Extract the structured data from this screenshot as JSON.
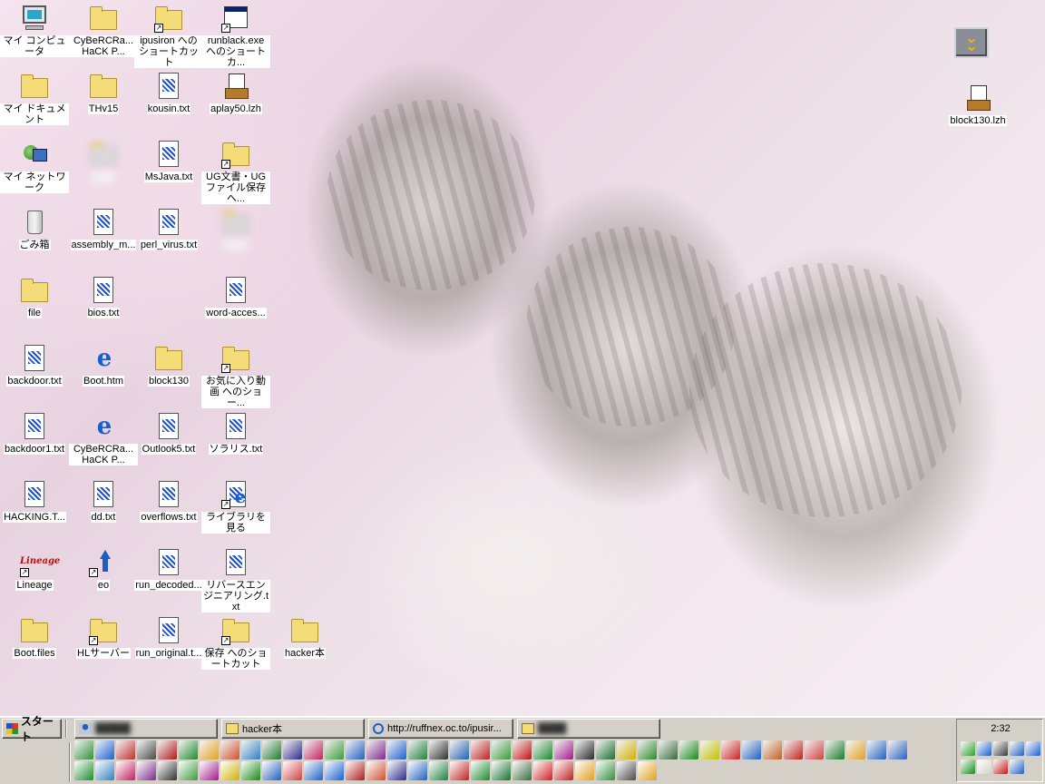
{
  "desktop": {
    "icons": [
      {
        "label": "マイ コンピュータ",
        "kind": "computer"
      },
      {
        "label": "CyBeRCRa... HaCK P...",
        "kind": "folder"
      },
      {
        "label": "ipusiron へのショートカット",
        "kind": "folder-shortcut"
      },
      {
        "label": "runblack.exe へのショートカ...",
        "kind": "exe-shortcut"
      },
      {
        "label": "マイ ドキュメント",
        "kind": "mydocs"
      },
      {
        "label": "THv15",
        "kind": "folder"
      },
      {
        "label": "kousin.txt",
        "kind": "doc"
      },
      {
        "label": "aplay50.lzh",
        "kind": "lzh"
      },
      {
        "label": "マイ ネットワーク",
        "kind": "network"
      },
      {
        "label": "",
        "kind": "blurred"
      },
      {
        "label": "MsJava.txt",
        "kind": "doc"
      },
      {
        "label": "UG文書・UGファイル保存 へ...",
        "kind": "folder-shortcut"
      },
      {
        "label": "ごみ箱",
        "kind": "trash"
      },
      {
        "label": "assembly_m...",
        "kind": "doc"
      },
      {
        "label": "perl_virus.txt",
        "kind": "doc"
      },
      {
        "label": "",
        "kind": "blurred"
      },
      {
        "label": "file",
        "kind": "folder"
      },
      {
        "label": "bios.txt",
        "kind": "doc"
      },
      {
        "label": "word-acces...",
        "kind": "doc"
      },
      {
        "label": "backdoor.txt",
        "kind": "doc"
      },
      {
        "label": "Boot.htm",
        "kind": "ie"
      },
      {
        "label": "block130",
        "kind": "folder"
      },
      {
        "label": "お気に入り動画 へのショー...",
        "kind": "folder-shortcut"
      },
      {
        "label": "backdoor1.txt",
        "kind": "doc"
      },
      {
        "label": "CyBeRCRa... HaCK P...",
        "kind": "ie"
      },
      {
        "label": "Outlook5.txt",
        "kind": "doc"
      },
      {
        "label": "ソラリス.txt",
        "kind": "doc"
      },
      {
        "label": "HACKING.T...",
        "kind": "doc"
      },
      {
        "label": "dd.txt",
        "kind": "doc"
      },
      {
        "label": "overflows.txt",
        "kind": "doc"
      },
      {
        "label": "ライブラリを見る",
        "kind": "ie-shortcut"
      },
      {
        "label": "Lineage",
        "kind": "lineage"
      },
      {
        "label": "eo",
        "kind": "eo"
      },
      {
        "label": "run_decoded...",
        "kind": "doc"
      },
      {
        "label": "リバースエンジニアリング.txt",
        "kind": "doc"
      },
      {
        "label": "Boot.files",
        "kind": "folder"
      },
      {
        "label": "HLサーバー",
        "kind": "folder-shortcut"
      },
      {
        "label": "run_original.t...",
        "kind": "doc"
      },
      {
        "label": "保存 へのショートカット",
        "kind": "folder-shortcut"
      },
      {
        "label": "hacker本",
        "kind": "folder"
      },
      {
        "label": "block130.lzh",
        "kind": "lzh"
      }
    ]
  },
  "taskbar": {
    "start_label": "スタート",
    "tasks": [
      {
        "label": "",
        "icon": "user-icon"
      },
      {
        "label": "hacker本",
        "icon": "folder-icon"
      },
      {
        "label": "http://ruffnex.oc.to/ipusir...",
        "icon": "ie-icon"
      },
      {
        "label": "",
        "icon": "folder-icon"
      }
    ],
    "clock": "2:32"
  },
  "colors": {
    "taskbar": "#d4d0c8",
    "label_bg": "#ffffff",
    "folder": "#f4dc78",
    "accent_blue": "#1a5fd0"
  }
}
